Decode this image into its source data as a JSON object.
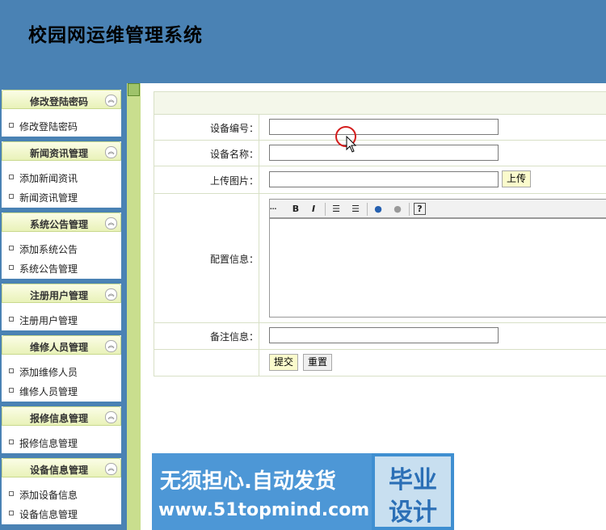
{
  "app": {
    "title": "校园网运维管理系统"
  },
  "sidebar": {
    "groups": [
      {
        "title": "修改登陆密码",
        "items": [
          "修改登陆密码"
        ]
      },
      {
        "title": "新闻资讯管理",
        "items": [
          "添加新闻资讯",
          "新闻资讯管理"
        ]
      },
      {
        "title": "系统公告管理",
        "items": [
          "添加系统公告",
          "系统公告管理"
        ]
      },
      {
        "title": "注册用户管理",
        "items": [
          "注册用户管理"
        ]
      },
      {
        "title": "维修人员管理",
        "items": [
          "添加维修人员",
          "维修人员管理"
        ]
      },
      {
        "title": "报修信息管理",
        "items": [
          "报修信息管理"
        ]
      },
      {
        "title": "设备信息管理",
        "items": [
          "添加设备信息",
          "设备信息管理"
        ]
      }
    ],
    "collapse_icon": "double-chevron-up-icon"
  },
  "form": {
    "device_no_label": "设备编号：",
    "device_no_value": "",
    "device_name_label": "设备名称：",
    "device_name_value": "",
    "upload_label": "上传图片：",
    "upload_value": "",
    "upload_button": "上传",
    "config_label": "配置信息：",
    "config_value": "",
    "remark_label": "备注信息：",
    "remark_value": "",
    "submit_button": "提交",
    "reset_button": "重置"
  },
  "editor": {
    "bold": "B",
    "italic": "I",
    "icons": [
      "ordered-list-icon",
      "unordered-list-icon",
      "insert-link-icon",
      "remove-link-icon",
      "help-icon"
    ]
  },
  "banner": {
    "line1": "无须担心.自动发货",
    "line2": "www.51topmind.com",
    "right_top": "毕业",
    "right_bottom": "设计"
  }
}
